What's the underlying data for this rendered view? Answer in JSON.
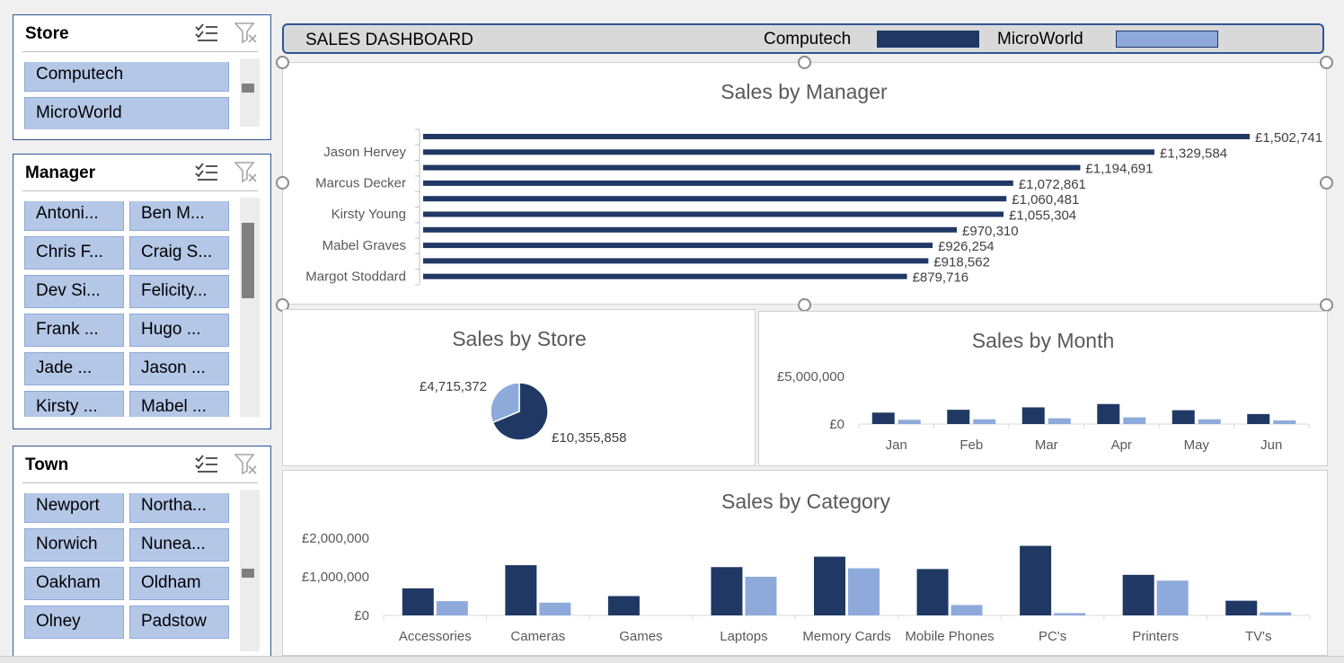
{
  "slicers": {
    "store": {
      "title": "Store",
      "items": [
        "Computech",
        "MicroWorld"
      ]
    },
    "manager": {
      "title": "Manager",
      "items": [
        "Antoni...",
        "Ben M...",
        "Chris F...",
        "Craig S...",
        "Dev Si...",
        "Felicity...",
        "Frank ...",
        "Hugo ...",
        "Jade ...",
        "Jason ...",
        "Kirsty ...",
        "Mabel ..."
      ]
    },
    "town": {
      "title": "Town",
      "items": [
        "Newport",
        "Northa...",
        "Norwich",
        "Nunea...",
        "Oakham",
        "Oldham",
        "Olney",
        "Padstow"
      ]
    },
    "icons": [
      "multi-select-icon",
      "clear-filter-icon"
    ]
  },
  "banner": {
    "title": "SALES DASHBOARD",
    "legend": [
      {
        "label": "Computech",
        "color": "#203864"
      },
      {
        "label": "MicroWorld",
        "color": "#8eaadb"
      }
    ]
  },
  "colors": {
    "computech": "#203864",
    "microworld": "#8eaadb",
    "accent_border": "#2f5597"
  },
  "chart_data": [
    {
      "id": "manager",
      "type": "bar",
      "orientation": "horizontal",
      "title": "Sales by Manager",
      "category_labels": [
        "Jason Hervey",
        "Marcus Decker",
        "Kirsty Young",
        "Mabel Graves",
        "Margot Stoddard"
      ],
      "data_labels": [
        "£1,502,741",
        "£1,329,584",
        "£1,194,691",
        "£1,072,861",
        "£1,060,481",
        "£1,055,304",
        "£970,310",
        "£926,254",
        "£918,562",
        "£879,716"
      ],
      "values": [
        1502741,
        1329584,
        1194691,
        1072861,
        1060481,
        1055304,
        970310,
        926254,
        918562,
        879716
      ]
    },
    {
      "id": "store",
      "type": "pie",
      "title": "Sales by Store",
      "labels": [
        "£10,355,858",
        "£4,715,372"
      ],
      "values": [
        10355858,
        4715372
      ]
    },
    {
      "id": "month",
      "type": "bar",
      "title": "Sales by Month",
      "categories": [
        "Jan",
        "Feb",
        "Mar",
        "Apr",
        "May",
        "Jun"
      ],
      "ytick_labels": [
        "£5,000,000",
        "£0"
      ],
      "ylim": [
        0,
        5000000
      ],
      "series": [
        {
          "values": [
            1200000,
            1500000,
            1750000,
            2100000,
            1450000,
            1050000
          ]
        },
        {
          "values": [
            450000,
            500000,
            600000,
            700000,
            500000,
            380000
          ]
        }
      ]
    },
    {
      "id": "category",
      "type": "bar",
      "title": "Sales by Category",
      "categories": [
        "Accessories",
        "Cameras",
        "Games",
        "Laptops",
        "Memory Cards",
        "Mobile Phones",
        "PC's",
        "Printers",
        "TV's"
      ],
      "ytick_labels": [
        "£2,000,000",
        "£1,000,000",
        "£0"
      ],
      "ylim": [
        0,
        2000000
      ],
      "series": [
        {
          "values": [
            700000,
            1300000,
            500000,
            1250000,
            1520000,
            1200000,
            1800000,
            1050000,
            380000
          ]
        },
        {
          "values": [
            370000,
            330000,
            0,
            1000000,
            1220000,
            270000,
            60000,
            900000,
            80000
          ]
        }
      ]
    }
  ]
}
